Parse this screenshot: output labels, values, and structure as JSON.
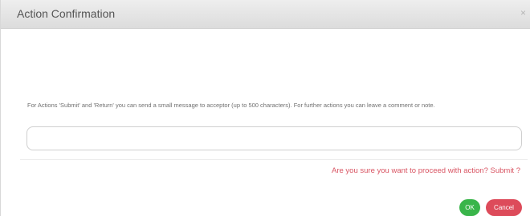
{
  "dialog": {
    "title": "Action Confirmation",
    "close_glyph": "×",
    "message": "For Actions 'Submit' and 'Return' you can send a small message to acceptor (up to 500 characters). For further actions you can leave a comment or note.",
    "comment": {
      "value": "",
      "placeholder": ""
    },
    "confirm_text": "Are you sure you want to proceed with action? Submit ?",
    "ok_label": "OK",
    "cancel_label": "Cancel"
  },
  "colors": {
    "confirm_text": "#d95563",
    "ok_button": "#39b54a",
    "cancel_button": "#dd4b5a"
  }
}
